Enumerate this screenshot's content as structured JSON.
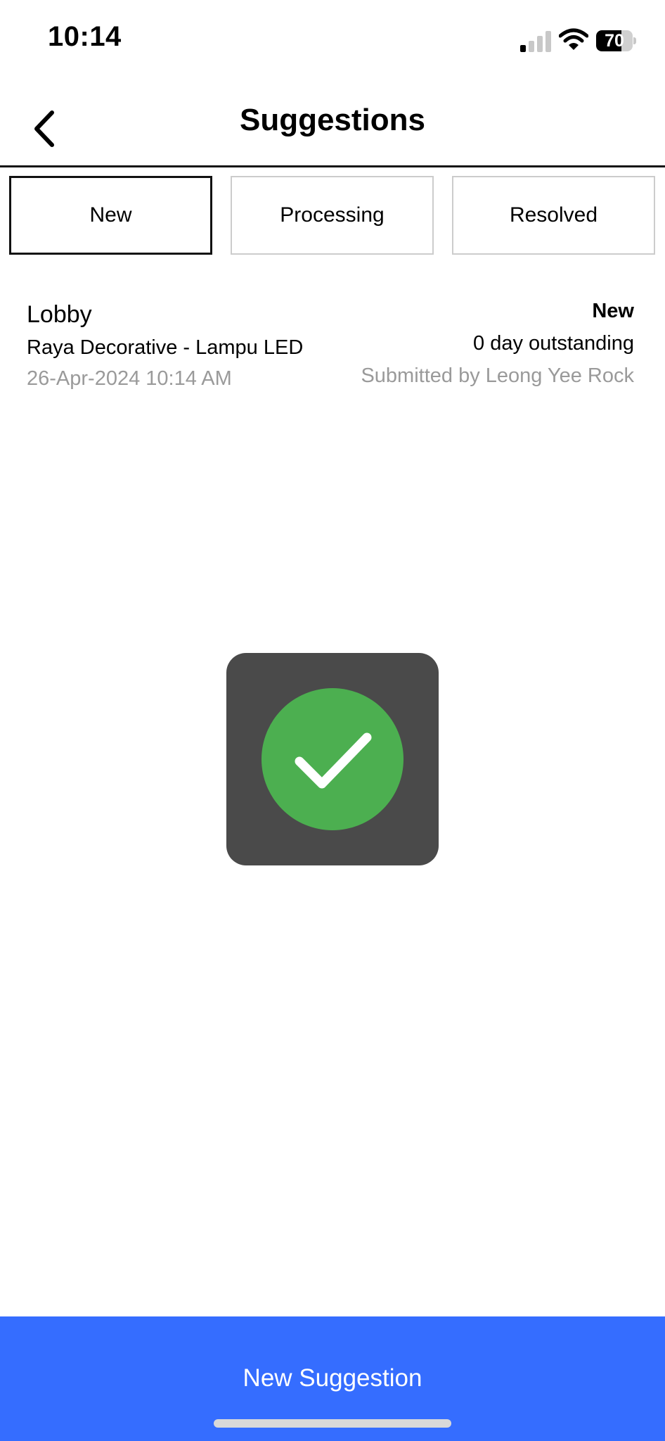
{
  "status_bar": {
    "time": "10:14",
    "battery": "70",
    "battery_level": 0.7,
    "signal_bars_active": 1,
    "signal_bars_total": 4
  },
  "header": {
    "title": "Suggestions",
    "back_icon": "chevron-left-icon"
  },
  "tabs": [
    {
      "label": "New",
      "active": true
    },
    {
      "label": "Processing",
      "active": false
    },
    {
      "label": "Resolved",
      "active": false
    }
  ],
  "suggestions": [
    {
      "location": "Lobby",
      "title": "Raya Decorative - Lampu LED",
      "date": "26-Apr-2024 10:14 AM",
      "status": "New",
      "outstanding": "0 day outstanding",
      "submitted_by": "Submitted by Leong Yee Rock"
    }
  ],
  "success_hud": {
    "icon": "checkmark-icon",
    "circle_color": "#4caf50",
    "background": "#4a4a4a"
  },
  "bottom_button": {
    "label": "New Suggestion",
    "color": "#356dff"
  }
}
